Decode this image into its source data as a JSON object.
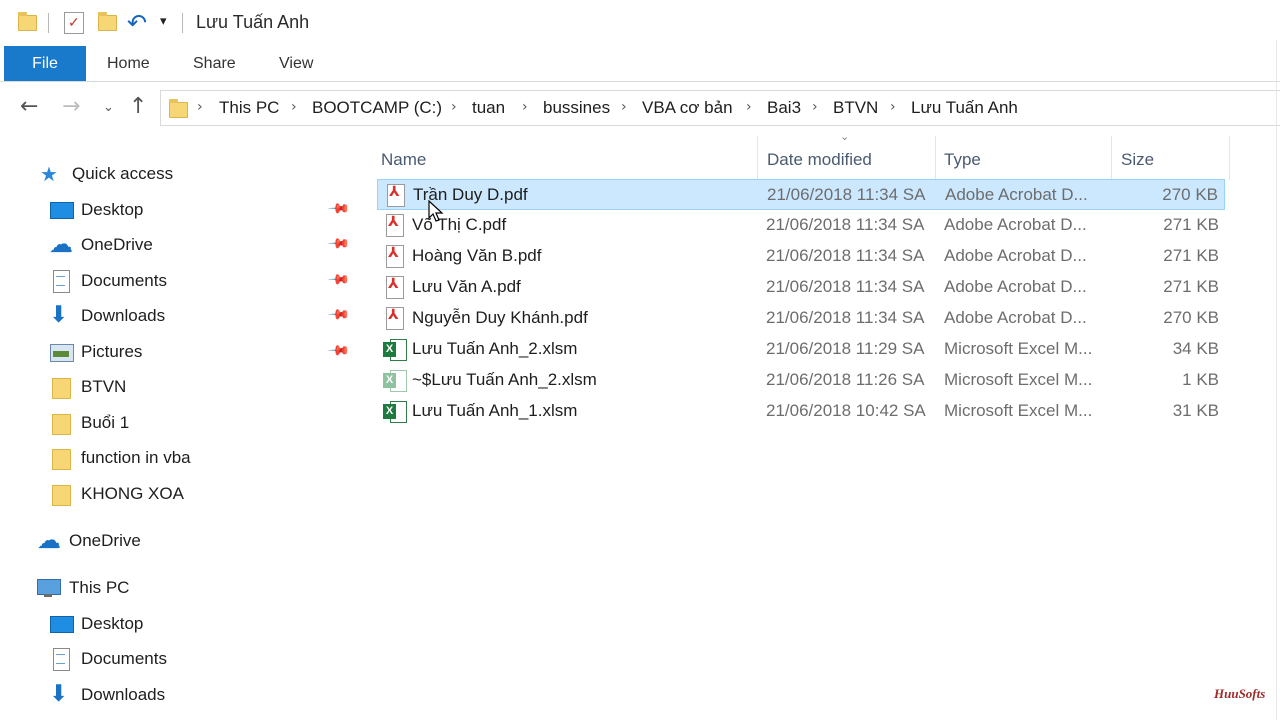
{
  "window": {
    "title": "Lưu Tuấn Anh"
  },
  "ribbon": {
    "tabs": [
      {
        "label": "File"
      },
      {
        "label": "Home"
      },
      {
        "label": "Share"
      },
      {
        "label": "View"
      }
    ]
  },
  "address": {
    "breadcrumbs": [
      "This PC",
      "BOOTCAMP (C:)",
      "tuan",
      "bussines",
      "VBA cơ bản",
      "Bai3",
      "BTVN",
      "Lưu Tuấn Anh"
    ]
  },
  "nav_icons": {
    "back": "←",
    "forward": "→",
    "recent": "⌄",
    "up": "↑",
    "separator": "›",
    "undo": "↶",
    "qat_dropdown": "▾",
    "quick_access_star": "★",
    "pin": "📌",
    "sort": "⌄"
  },
  "sidebar": {
    "quick_access": {
      "label": "Quick access",
      "items": [
        {
          "label": "Desktop",
          "icon": "desktop-icon",
          "pinned": true
        },
        {
          "label": "OneDrive",
          "icon": "cloud-icon",
          "pinned": true
        },
        {
          "label": "Documents",
          "icon": "documents-icon",
          "pinned": true
        },
        {
          "label": "Downloads",
          "icon": "downloads-icon",
          "pinned": true
        },
        {
          "label": "Pictures",
          "icon": "pictures-icon",
          "pinned": true
        },
        {
          "label": "BTVN",
          "icon": "folder-icon",
          "pinned": false
        },
        {
          "label": "Buổi 1",
          "icon": "folder-icon",
          "pinned": false
        },
        {
          "label": "function in vba",
          "icon": "folder-icon",
          "pinned": false
        },
        {
          "label": "KHONG XOA",
          "icon": "folder-icon",
          "pinned": false
        }
      ]
    },
    "onedrive": {
      "label": "OneDrive"
    },
    "this_pc": {
      "label": "This PC",
      "items": [
        {
          "label": "Desktop",
          "icon": "desktop-icon"
        },
        {
          "label": "Documents",
          "icon": "documents-icon"
        },
        {
          "label": "Downloads",
          "icon": "downloads-icon"
        }
      ]
    }
  },
  "filelist": {
    "columns": {
      "name": "Name",
      "date": "Date modified",
      "type": "Type",
      "size": "Size"
    },
    "rows": [
      {
        "name": "Trần Duy D.pdf",
        "date": "21/06/2018 11:34 SA",
        "type": "Adobe Acrobat D...",
        "size": "270 KB",
        "icon": "pdf-icon",
        "selected": true
      },
      {
        "name": "Võ Thị C.pdf",
        "date": "21/06/2018 11:34 SA",
        "type": "Adobe Acrobat D...",
        "size": "271 KB",
        "icon": "pdf-icon",
        "selected": false
      },
      {
        "name": "Hoàng Văn B.pdf",
        "date": "21/06/2018 11:34 SA",
        "type": "Adobe Acrobat D...",
        "size": "271 KB",
        "icon": "pdf-icon",
        "selected": false
      },
      {
        "name": "Lưu Văn A.pdf",
        "date": "21/06/2018 11:34 SA",
        "type": "Adobe Acrobat D...",
        "size": "271 KB",
        "icon": "pdf-icon",
        "selected": false
      },
      {
        "name": "Nguyễn Duy Khánh.pdf",
        "date": "21/06/2018 11:34 SA",
        "type": "Adobe Acrobat D...",
        "size": "270 KB",
        "icon": "pdf-icon",
        "selected": false
      },
      {
        "name": "Lưu Tuấn Anh_2.xlsm",
        "date": "21/06/2018 11:29 SA",
        "type": "Microsoft Excel M...",
        "size": "34 KB",
        "icon": "excel-icon",
        "selected": false
      },
      {
        "name": "~$Lưu Tuấn Anh_2.xlsm",
        "date": "21/06/2018 11:26 SA",
        "type": "Microsoft Excel M...",
        "size": "1 KB",
        "icon": "excel-temp-icon",
        "selected": false
      },
      {
        "name": "Lưu Tuấn Anh_1.xlsm",
        "date": "21/06/2018 10:42 SA",
        "type": "Microsoft Excel M...",
        "size": "31 KB",
        "icon": "excel-icon",
        "selected": false
      }
    ]
  },
  "watermark": {
    "text": "HuuSofts"
  },
  "colors": {
    "file_tab": "#1979ca",
    "selection": "#cce8ff",
    "selection_border": "#99d1ff",
    "accent_blue": "#1a72c7"
  }
}
